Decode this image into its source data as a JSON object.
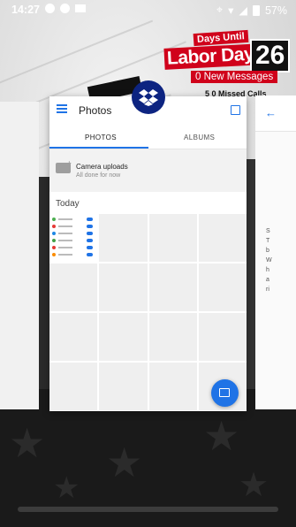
{
  "status_bar": {
    "time": "14:27",
    "battery": "57%"
  },
  "wallpaper": {
    "banner": {
      "days_until": "Days Until",
      "labor_day": "Labor Day:",
      "count": "26",
      "messages": "0 New Messages",
      "calls": "5  0 Missed Calls"
    }
  },
  "recents": {
    "active_app": {
      "name": "Dropbox",
      "app_bar_title": "Photos",
      "tabs": [
        {
          "label": "PHOTOS",
          "selected": true
        },
        {
          "label": "ALBUMS",
          "selected": false
        }
      ],
      "camera_uploads": {
        "title": "Camera uploads",
        "subtitle": "All done for now"
      },
      "section_header": "Today",
      "accent_color": "#1f73e6",
      "logo_color": "#0d2481"
    }
  }
}
